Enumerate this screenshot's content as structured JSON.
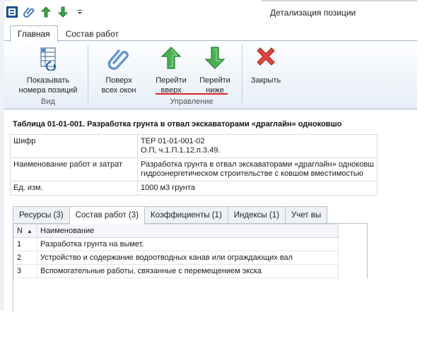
{
  "window": {
    "title": "Детализация позиции"
  },
  "ribbon_tabs": [
    {
      "label": "Главная"
    },
    {
      "label": "Состав работ"
    }
  ],
  "ribbon": {
    "show_numbers": {
      "line1": "Показывать",
      "line2": "номера позиций"
    },
    "group_view": "Вид",
    "on_top": {
      "line1": "Поверх",
      "line2": "всех окон"
    },
    "go_up": {
      "line1": "Перейти",
      "line2": "вверх"
    },
    "go_down": {
      "line1": "Перейти",
      "line2": "ниже"
    },
    "close": {
      "line1": "Закрыть"
    },
    "group_control": "Управление"
  },
  "heading": "Таблица 01-01-001. Разработка грунта в отвал экскаваторами «драглайн» одноковшо",
  "properties": [
    {
      "key": "Шифр",
      "value1": "ТЕР 01-01-001-02",
      "value2": "О.П, ч.1.П.1.12.п.3.49."
    },
    {
      "key": "Наименование работ и затрат",
      "value1": "Разработка грунта в отвал экскаваторами «драглайн» одноковш",
      "value2": "гидроэнергетическом строительстве с ковшом вместимостью"
    },
    {
      "key": "Ед. изм.",
      "value1": "1000 м3 грунта",
      "value2": ""
    }
  ],
  "lower_tabs": [
    {
      "label": "Ресурсы (3)"
    },
    {
      "label": "Состав работ (3)"
    },
    {
      "label": "Коэффициенты (1)"
    },
    {
      "label": "Индексы (1)"
    },
    {
      "label": "Учет вы"
    }
  ],
  "grid": {
    "columns": {
      "n": "N",
      "name": "Наименование"
    },
    "rows": [
      {
        "n": "1",
        "name": "Разработка грунта на вымет."
      },
      {
        "n": "2",
        "name": "Устройство и содержание водоотводных канав или ограждающих вал"
      },
      {
        "n": "3",
        "name": "Вспомогательные работы, связанные с перемещением экска"
      }
    ]
  },
  "colors": {
    "accent_blue": "#1c5aa6",
    "arrow_green": "#3aa544",
    "close_red": "#d9302c",
    "underline_red": "#dd2222"
  }
}
